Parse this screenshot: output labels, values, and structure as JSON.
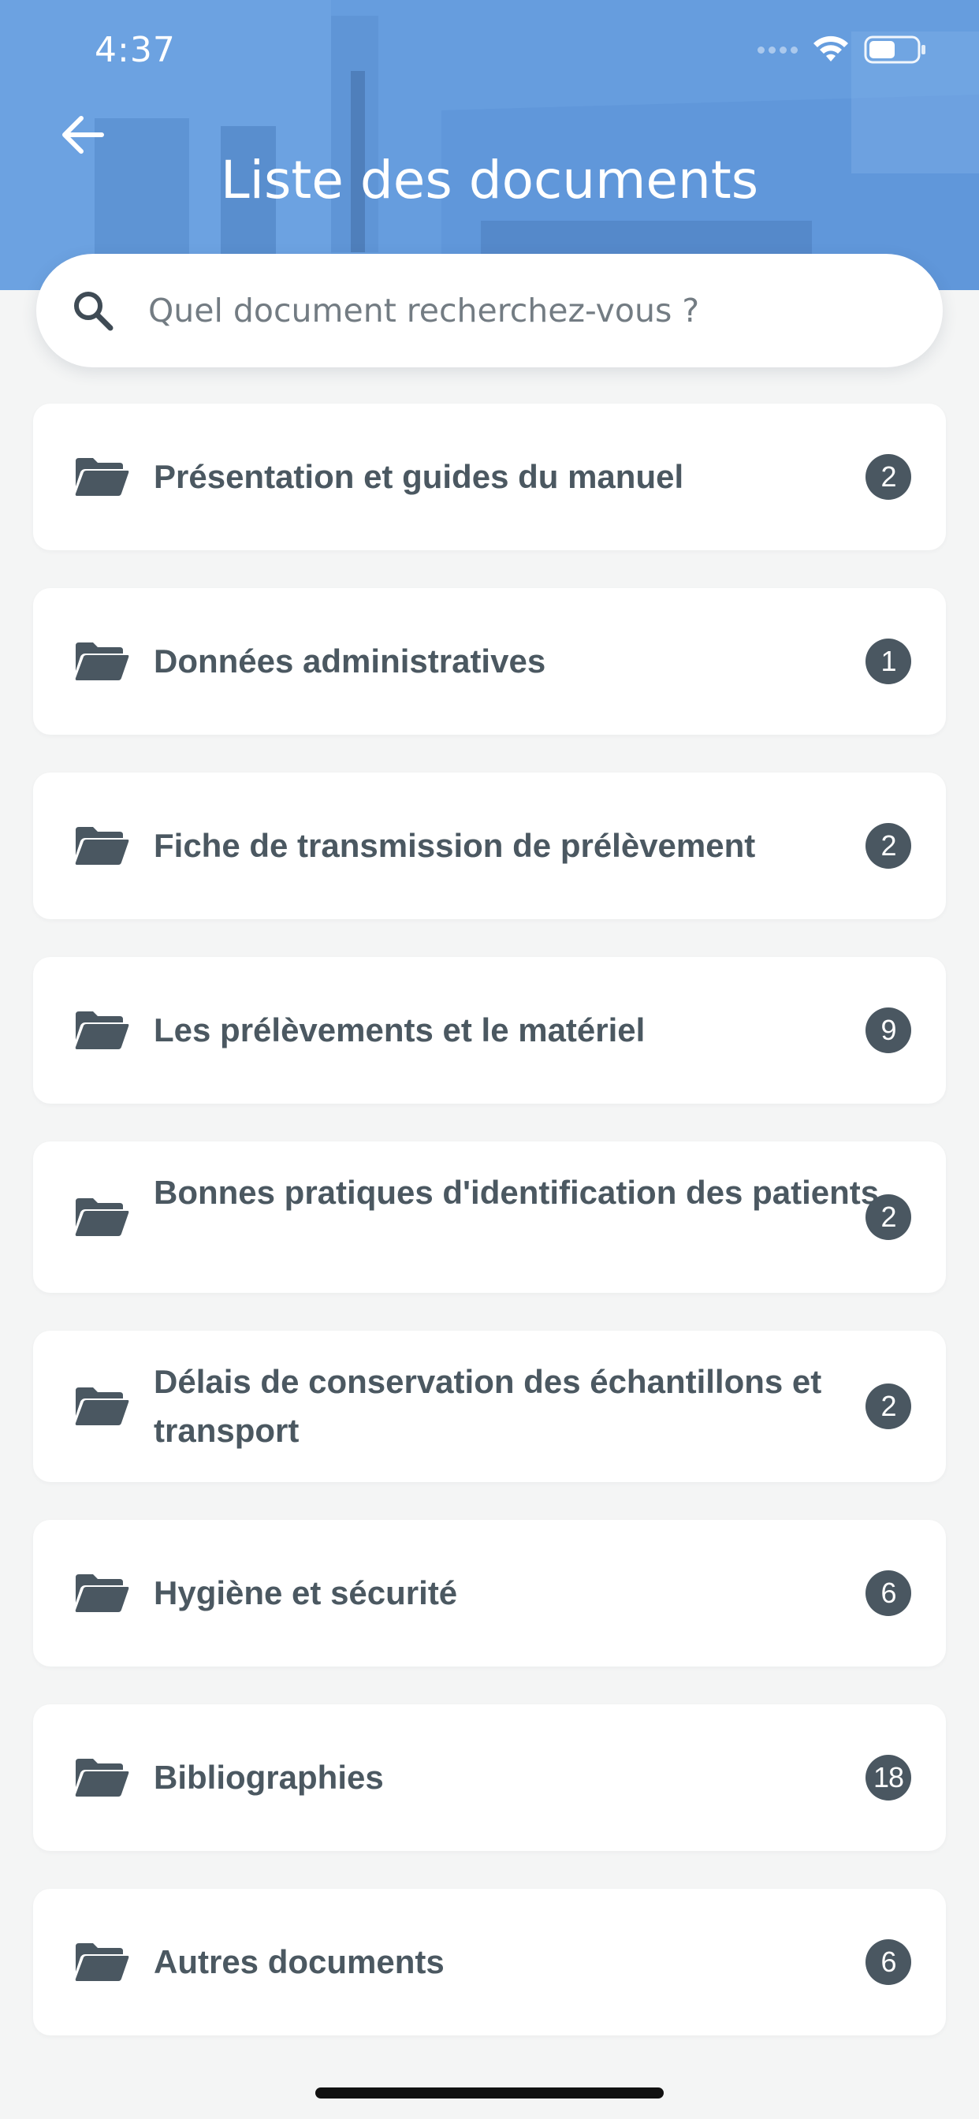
{
  "status_bar": {
    "time": "4:37"
  },
  "header": {
    "title": "Liste des documents",
    "background_color": "#5f97dc"
  },
  "search": {
    "placeholder": "Quel document recherchez-vous ?"
  },
  "documents": [
    {
      "title": "Présentation et guides du manuel",
      "count": "2"
    },
    {
      "title": "Données administratives",
      "count": "1"
    },
    {
      "title": "Fiche de transmission de prélèvement",
      "count": "2"
    },
    {
      "title": "Les prélèvements et le matériel",
      "count": "9"
    },
    {
      "title": "Bonnes pratiques d'identification des patients",
      "count": "2"
    },
    {
      "title": "Délais de conservation des échantillons et transport",
      "count": "2"
    },
    {
      "title": "Hygiène et sécurité",
      "count": "6"
    },
    {
      "title": "Bibliographies",
      "count": "18"
    },
    {
      "title": "Autres documents",
      "count": "6"
    }
  ],
  "icons": {
    "back": "arrow-left-icon",
    "search": "search-icon",
    "folder": "folder-open-icon",
    "wifi": "wifi-icon",
    "battery": "battery-icon"
  },
  "colors": {
    "badge": "#4a5761",
    "text": "#4b5861",
    "page_background": "#f4f5f5"
  }
}
